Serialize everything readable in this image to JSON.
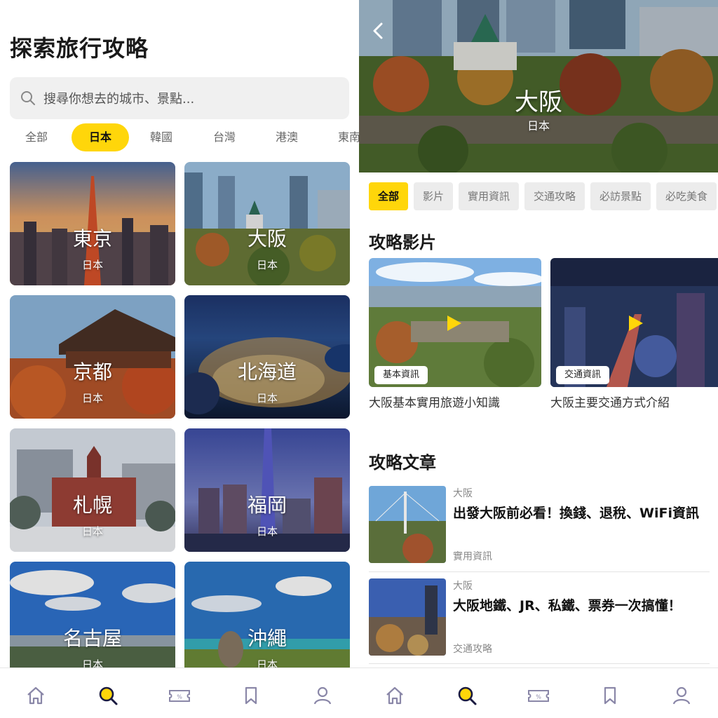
{
  "left_screen": {
    "page_title": "探索旅行攻略",
    "search": {
      "placeholder": "搜尋你想去的城市、景點..."
    },
    "country_tabs": [
      "全部",
      "日本",
      "韓國",
      "台灣",
      "港澳",
      "東南"
    ],
    "active_country_tab": "日本",
    "cities": [
      {
        "name": "東京",
        "country": "日本"
      },
      {
        "name": "大阪",
        "country": "日本"
      },
      {
        "name": "京都",
        "country": "日本"
      },
      {
        "name": "北海道",
        "country": "日本"
      },
      {
        "name": "札幌",
        "country": "日本"
      },
      {
        "name": "福岡",
        "country": "日本"
      },
      {
        "name": "名古屋",
        "country": "日本"
      },
      {
        "name": "沖繩",
        "country": "日本"
      }
    ]
  },
  "right_screen": {
    "hero": {
      "city": "大阪",
      "country": "日本"
    },
    "filter_chips": [
      "全部",
      "影片",
      "實用資訊",
      "交通攻略",
      "必訪景點",
      "必吃美食"
    ],
    "active_filter_chip": "全部",
    "videos_section_title": "攻略影片",
    "videos": [
      {
        "badge": "基本資訊",
        "title": "大阪基本實用旅遊小知識"
      },
      {
        "badge": "交通資訊",
        "title": "大阪主要交通方式介紹"
      }
    ],
    "articles_section_title": "攻略文章",
    "articles": [
      {
        "city": "大阪",
        "title": "出發大阪前必看！換錢、退稅、WiFi資訊",
        "category": "實用資訊"
      },
      {
        "city": "大阪",
        "title": "大阪地鐵、JR、私鐵、票券一次搞懂！",
        "category": "交通攻略"
      }
    ]
  },
  "bottom_nav": {
    "items": [
      "home-icon",
      "search-icon",
      "ticket-icon",
      "bookmark-icon",
      "profile-icon"
    ],
    "active": "search-icon"
  },
  "colors": {
    "accent": "#ffd60a",
    "nav_icon": "#8a87a8",
    "chip_bg": "#ececec"
  }
}
